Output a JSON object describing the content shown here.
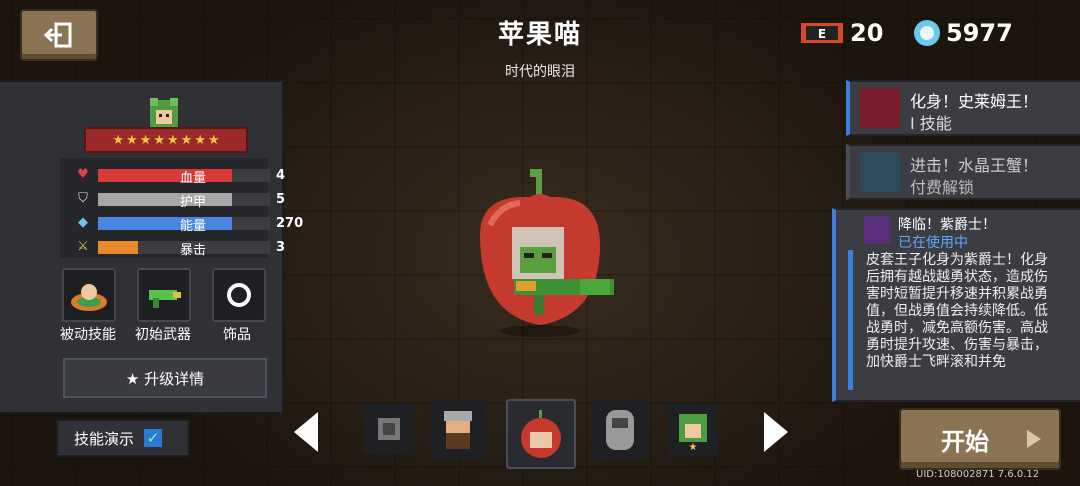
{
  "header": {
    "character_name": "苹果喵",
    "skin_name": "时代的眼泪",
    "energy_count": "20",
    "gems_count": "5977"
  },
  "stats": [
    {
      "label": "血量",
      "value": "4",
      "icon": "heart-icon",
      "color": "#d83a3a",
      "fill": 1.0
    },
    {
      "label": "护甲",
      "value": "5",
      "icon": "shield-icon",
      "color": "#a7a7a7",
      "fill": 1.0
    },
    {
      "label": "能量",
      "value": "270",
      "icon": "energy-diamond-icon",
      "color": "#4a86e0",
      "fill": 1.0
    },
    {
      "label": "暴击",
      "value": "3",
      "icon": "sword-icon",
      "color": "#e88a2a",
      "fill": 0.3
    }
  ],
  "loadout": {
    "passive_label": "被动技能",
    "weapon_label": "初始武器",
    "accessory_label": "饰品"
  },
  "upgrade_label": "★ 升级详情",
  "skill_demo_label": "技能演示",
  "skills": [
    {
      "title": "化身！史莱姆王！",
      "subtitle": "I 技能"
    },
    {
      "title": "进击！水晶王蟹！",
      "subtitle": "付费解锁"
    }
  ],
  "active_skill": {
    "title": "降临！紫爵士！",
    "status": "已在使用中",
    "description": "皮套王子化身为紫爵士！化身后拥有越战越勇状态，造成伤害时短暂提升移速并积累战勇值，但战勇值会持续降低。低战勇时，减免高额伤害。高战勇时提升攻速、伤害与暴击，加快爵士飞畔滚和并免"
  },
  "start_label": "开始",
  "uid_text": "UID:108002871 7.6.0.12",
  "colors": {
    "accent_blue": "#3b7fe0",
    "button_tan": "#8a7453",
    "star_gold": "#f5c542"
  }
}
